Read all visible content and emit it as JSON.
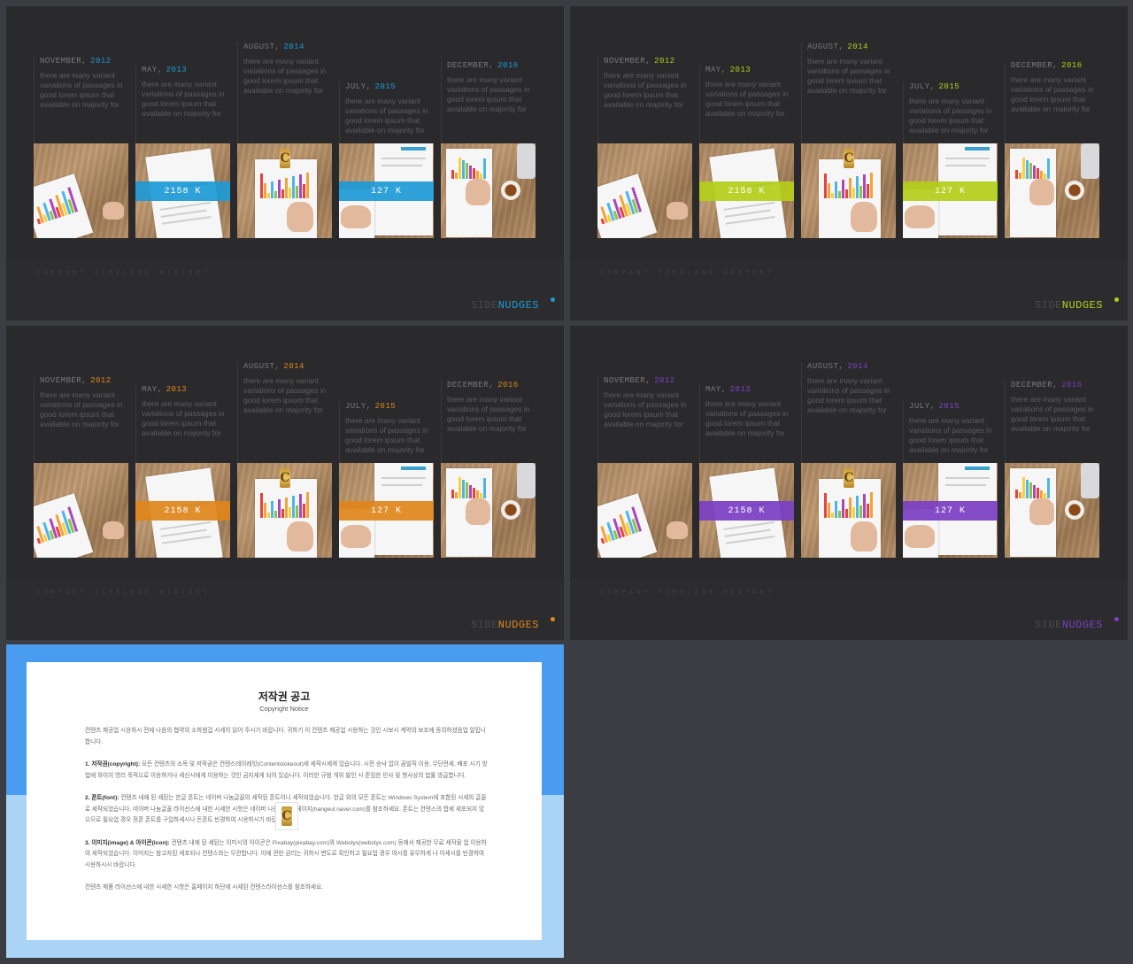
{
  "slides": [
    {
      "accent": "#1e9ad6",
      "subtitle": "COMPANY TIMELINE HISTORY",
      "brand_a": "SIDE",
      "brand_b": "NUDGES",
      "columns": [
        {
          "month": "NOVEMBER,",
          "year": "2012",
          "text": "there are many variant variations of passages in good lorem ipsum that available on majority for"
        },
        {
          "month": "MAY,",
          "year": "2013",
          "text": "there are many variant variations of passages in good lorem ipsum that available on majority for"
        },
        {
          "month": "AUGUST,",
          "year": "2014",
          "text": "there are many variant variations of passages in good lorem ipsum that available on majority for"
        },
        {
          "month": "JULY,",
          "year": "2015",
          "text": "there are many variant variations of passages in good lorem ipsum that available on majority for"
        },
        {
          "month": "DECEMBER,",
          "year": "2016",
          "text": "there are many variant variations of passages in good lorem ipsum that available on majority for"
        }
      ],
      "band1": "2158 K",
      "band2": "127 K"
    },
    {
      "accent": "#b4cf1a",
      "subtitle": "COMPANY TIMELINE HISTORY",
      "brand_a": "SIDE",
      "brand_b": "NUDGES",
      "columns": [
        {
          "month": "NOVEMBER,",
          "year": "2012",
          "text": "there are many variant variations of passages in good lorem ipsum that available on majority for"
        },
        {
          "month": "MAY,",
          "year": "2013",
          "text": "there are many variant variations of passages in good lorem ipsum that available on majority for"
        },
        {
          "month": "AUGUST,",
          "year": "2014",
          "text": "there are many variant variations of passages in good lorem ipsum that available on majority for"
        },
        {
          "month": "JULY,",
          "year": "2015",
          "text": "there are many variant variations of passages in good lorem ipsum that available on majority for"
        },
        {
          "month": "DECEMBER,",
          "year": "2016",
          "text": "there are many variant variations of passages in good lorem ipsum that available on majority for"
        }
      ],
      "band1": "2158 K",
      "band2": "127 K"
    },
    {
      "accent": "#e0861c",
      "subtitle": "COMPANY TIMELINE HISTORY",
      "brand_a": "SIDE",
      "brand_b": "NUDGES",
      "columns": [
        {
          "month": "NOVEMBER,",
          "year": "2012",
          "text": "there are many variant variations of passages in good lorem ipsum that available on majority for"
        },
        {
          "month": "MAY,",
          "year": "2013",
          "text": "there are many variant variations of passages in good lorem ipsum that available on majority for"
        },
        {
          "month": "AUGUST,",
          "year": "2014",
          "text": "there are many variant variations of passages in good lorem ipsum that available on majority for"
        },
        {
          "month": "JULY,",
          "year": "2015",
          "text": "there are many variant variations of passages in good lorem ipsum that available on majority for"
        },
        {
          "month": "DECEMBER,",
          "year": "2016",
          "text": "there are many variant variations of passages in good lorem ipsum that available on majority for"
        }
      ],
      "band1": "2158 K",
      "band2": "127 K"
    },
    {
      "accent": "#7b3fc4",
      "subtitle": "COMPANY TIMELINE HISTORY",
      "brand_a": "SIDE",
      "brand_b": "NUDGES",
      "columns": [
        {
          "month": "NOVEMBER,",
          "year": "2012",
          "text": "there are many variant variations of passages in good lorem ipsum that available on majority for"
        },
        {
          "month": "MAY,",
          "year": "2013",
          "text": "there are many variant variations of passages in good lorem ipsum that available on majority for"
        },
        {
          "month": "AUGUST,",
          "year": "2014",
          "text": "there are many variant variations of passages in good lorem ipsum that available on majority for"
        },
        {
          "month": "JULY,",
          "year": "2015",
          "text": "there are many variant variations of passages in good lorem ipsum that available on majority for"
        },
        {
          "month": "DECEMBER,",
          "year": "2016",
          "text": "there are many variant variations of passages in good lorem ipsum that available on majority for"
        }
      ],
      "band1": "2158 K",
      "band2": "127 K"
    }
  ],
  "logo_letter": "C",
  "notice": {
    "title": "저작권 공고",
    "subtitle": "Copyright Notice",
    "intro": "컨텐츠 제공업 시용하시 전에 나음의 협약의 소하범겁 시세히 읽어 주시기 바랍니다. 귀하기 이 컨텐츠 제공업 시용하는 것인 시보시 계약의 보조에 동의하셨음업 알립니합니다.",
    "p1_head": "1. 저작권(copyright):",
    "p1": "모든 컨텐츠의 소목 및 저작권은 컨텐스테이레잇(Contentstokeout)세 세작시세게 있습니다. 시전 승낙 없이 끔빌직 이용, 무단전세, 배포 시기 방법에 와이이 영리 목적으로 이용하거나 세신시에게 이용하는 것인 금지세게 되어 있습니다. 이러한 규범 개위 발인 시 준임한 민사 및 형사상의 법률 방급합니다.",
    "p2_head": "2. 폰트(font):",
    "p2": "컨텐츠 내에 된 세된는 한글 폰트는 네이버 나눔글꼴의 세작된 폰트이니 세작되었습니다. 한글 외의 모든 폰트는 Windows System에 포함된 시세의 글꼴로 세작되었습니다. 네이버 나눔글꼴 라이선스에 내한 시세한 시항은 네이버 나눔글꼴 홈페이지(hangeul.naver.com)를 참조하세요. 폰트는 컨텐스의 합세 세포되지 않으므로 필요업 경우 정폰 폰트를 구입하세시나 돈폰트 빈경하여 시용하시기 바랍니다.",
    "p3_head": "3. 이미지(image) & 아이콘(icon):",
    "p3": "컨텐츠 내에 된 세된는 이미시의 아이콘은 Pixabay(pixabay.com)와 Webolys(webolys.com) 등에서 제공한 무료 세작물 업 이용하여 세작되었습니다. 이미지는 참고자된 세포되나 컨텐스와는 무관합니다. 이에 관한 권리는 귀하시 변도로 확인하고 필요업 경우 여시를 유무하게 나 이세시를 빈경하여 시용하시시 바랍니다.",
    "outro": "컨텐츠 제품 라이선스에 내한 시세한 시항은 홈페이지 하단에 시세된 컨텐스라이선스를 참조하세요."
  }
}
